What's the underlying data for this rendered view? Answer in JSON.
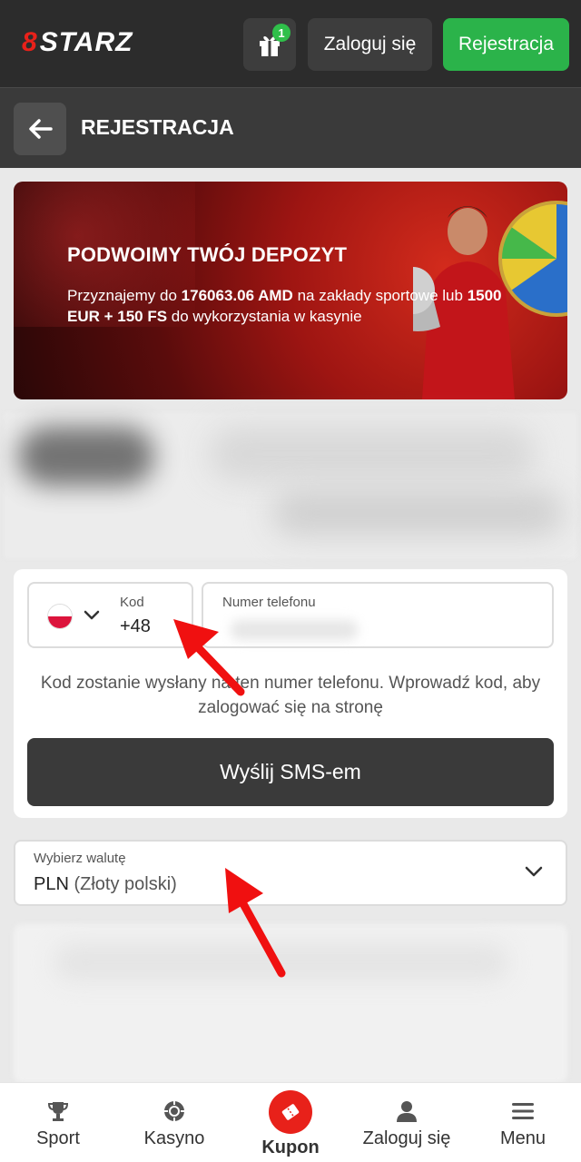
{
  "header": {
    "logo": "STARZ",
    "logo_mark": "8",
    "gift_badge": "1",
    "login_label": "Zaloguj się",
    "register_label": "Rejestracja"
  },
  "subheader": {
    "title": "REJESTRACJA"
  },
  "banner": {
    "title": "PODWOIMY TWÓJ DEPOZYT",
    "text_prefix": "Przyznajemy do ",
    "amount_1": "176063.06 AMD",
    "text_middle": " na zakłady sportowe lub ",
    "amount_2": "1500 EUR + 150 FS",
    "text_suffix": " do wykorzystania w kasynie"
  },
  "phone_form": {
    "code_label": "Kod",
    "code_value": "+48",
    "phone_label": "Numer telefonu",
    "hint": "Kod zostanie wysłany na ten numer telefonu. Wprowadź kod, aby zalogować się na stronę",
    "sms_button": "Wyślij SMS-em"
  },
  "currency": {
    "label": "Wybierz walutę",
    "value_code": "PLN",
    "value_name": " (Złoty polski)"
  },
  "bottom_nav": {
    "items": [
      {
        "label": "Sport",
        "icon": "trophy-icon"
      },
      {
        "label": "Kasyno",
        "icon": "casino-chip-icon"
      },
      {
        "label": "Kupon",
        "icon": "ticket-icon"
      },
      {
        "label": "Zaloguj się",
        "icon": "user-icon"
      },
      {
        "label": "Menu",
        "icon": "hamburger-icon"
      }
    ]
  },
  "colors": {
    "header_bg": "#2c2c2c",
    "accent_green": "#2bb34a",
    "accent_red": "#e8211a",
    "button_dark": "#3a3a3a"
  }
}
